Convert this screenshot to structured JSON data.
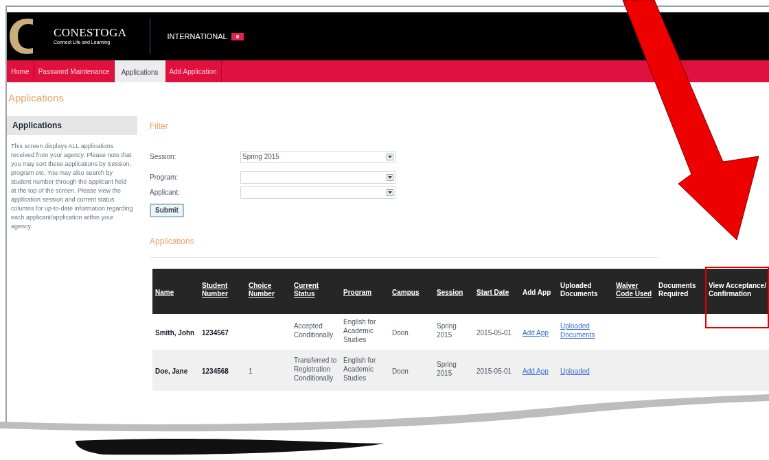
{
  "header": {
    "logo_name": "CONESTOGA",
    "logo_tagline": "Connect Life and Learning",
    "section": "INTERNATIONAL"
  },
  "nav": [
    {
      "label": "Home",
      "selected": false
    },
    {
      "label": "Password Maintenance",
      "selected": false
    },
    {
      "label": "Applications",
      "selected": true
    },
    {
      "label": "Add Application",
      "selected": false
    }
  ],
  "page_title": "Applications",
  "sidebar": {
    "heading": "Applications",
    "text": "This screen displays ALL applications received from your agency. Please note that you may sort these applications by Session, program etc. You may also search by student number through the applicant field at the top of the screen. Please view the application session and current status columns for up-to-date information regarding each applicant/application within your agency."
  },
  "filter": {
    "heading": "Filter",
    "fields": [
      {
        "label": "Session:",
        "value": "Spring 2015"
      },
      {
        "label": "Program:"
      },
      {
        "label": "Applicant:"
      }
    ],
    "submit": "Submit"
  },
  "applications": {
    "heading": "Applications",
    "columns": [
      {
        "label": "Name",
        "sortable": true
      },
      {
        "label": "Student Number",
        "sortable": true
      },
      {
        "label": "Choice Number",
        "sortable": true
      },
      {
        "label": "Current Status",
        "sortable": true
      },
      {
        "label": "Program",
        "sortable": true
      },
      {
        "label": "Campus",
        "sortable": true
      },
      {
        "label": "Session",
        "sortable": true
      },
      {
        "label": "Start Date",
        "sortable": true
      },
      {
        "label": "Add App",
        "sortable": false
      },
      {
        "label": "Uploaded Documents",
        "sortable": false
      },
      {
        "label": "Waiver Code Used",
        "sortable": true
      },
      {
        "label": "Documents Required",
        "sortable": false
      },
      {
        "label": "View Acceptance/ Confirmation",
        "sortable": false
      }
    ],
    "rows": [
      {
        "name": "Smith, John",
        "student_number": "1234567",
        "status": "Accepted Conditionally",
        "program": "English for Academic Studies",
        "campus": "Doon",
        "session": "Spring 2015",
        "start_date": "2015-05-01",
        "add_app": "Add App",
        "uploaded": "Uploaded Documents"
      },
      {
        "name": "Doe, Jane",
        "student_number": "1234568",
        "choice": "1",
        "status": "Transferred to Registration Conditionally",
        "program": "English for Academic Studies",
        "campus": "Doon",
        "session": "Spring 2015",
        "start_date": "2015-05-01",
        "add_app": "Add App",
        "uploaded": "Uploaded"
      }
    ]
  }
}
